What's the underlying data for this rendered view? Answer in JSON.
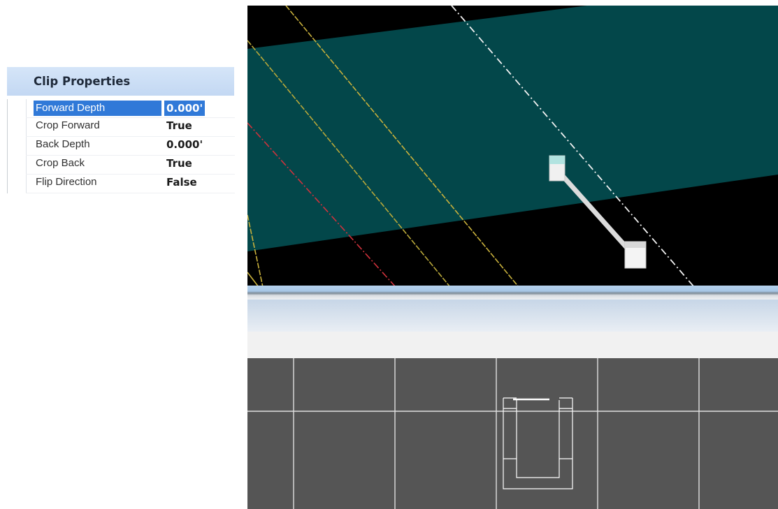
{
  "panel": {
    "title": "Clip Properties",
    "properties": [
      {
        "name": "Forward Depth",
        "value": "0.000'",
        "selected": true
      },
      {
        "name": "Crop Forward",
        "value": "True",
        "selected": false
      },
      {
        "name": "Back Depth",
        "value": "0.000'",
        "selected": false
      },
      {
        "name": "Crop Back",
        "value": "True",
        "selected": false
      },
      {
        "name": "Flip Direction",
        "value": "False",
        "selected": false
      }
    ]
  },
  "colors": {
    "selection": "#3079d8",
    "viewport_background": "#000000",
    "clip_plane": "#03474a",
    "plan_background": "#555555",
    "gridline": "#e0e0e0"
  }
}
